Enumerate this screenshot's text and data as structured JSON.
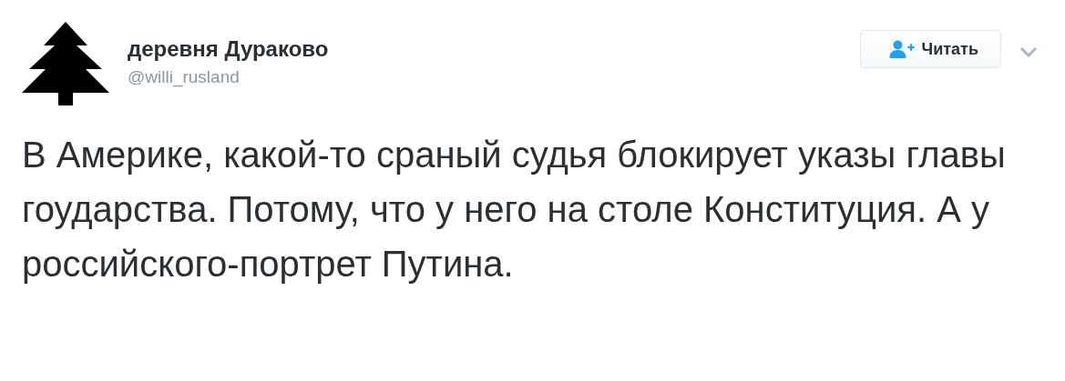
{
  "author": {
    "name": "деревня Дураково",
    "handle": "@willi_rusland"
  },
  "follow_button": {
    "label": "Читать"
  },
  "tweet": {
    "text": "В Америке, какой-то сраный судья блокирует указы главы гоударства. Потому, что у него на столе Конституция. А у российского-портрет Путина."
  }
}
